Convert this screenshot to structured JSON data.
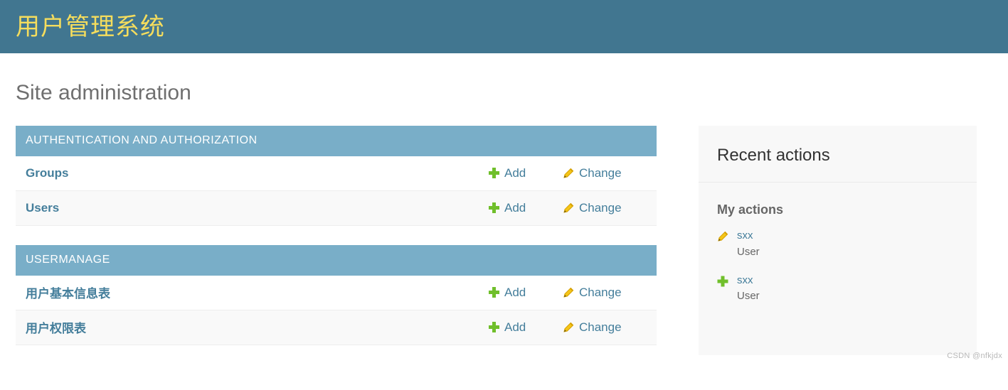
{
  "header": {
    "title": "用户管理系统",
    "brand_bg": "#417690",
    "brand_fg": "#f5dd5d"
  },
  "page": {
    "title": "Site administration"
  },
  "colors": {
    "module_caption_bg": "#79aec8",
    "link": "#447e9b",
    "add_icon": "#70bf2b",
    "change_icon": "#efb80b"
  },
  "app_modules": [
    {
      "caption": "Authentication and Authorization",
      "rows": [
        {
          "name": "Groups",
          "add_label": "Add",
          "change_label": "Change"
        },
        {
          "name": "Users",
          "add_label": "Add",
          "change_label": "Change"
        }
      ]
    },
    {
      "caption": "Usermanage",
      "rows": [
        {
          "name": "用户基本信息表",
          "add_label": "Add",
          "change_label": "Change"
        },
        {
          "name": "用户权限表",
          "add_label": "Add",
          "change_label": "Change"
        }
      ]
    }
  ],
  "sidebar": {
    "title": "Recent actions",
    "subtitle": "My actions",
    "actions": [
      {
        "icon": "pencil-icon",
        "object": "sxx",
        "model": "User"
      },
      {
        "icon": "plus-icon",
        "object": "sxx",
        "model": "User"
      }
    ]
  },
  "watermark": {
    "text": "CSDN @nfkjdx"
  }
}
